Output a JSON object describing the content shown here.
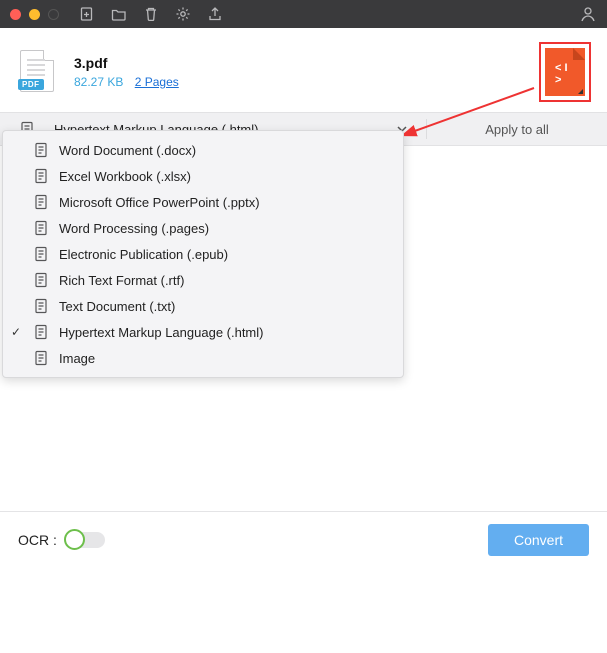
{
  "file": {
    "name": "3.pdf",
    "size": "82.27 KB",
    "pages_link": "2 Pages",
    "badge": "PDF",
    "target_code_glyph": "< I >"
  },
  "format_bar": {
    "selected": "Hypertext Markup Language (.html)",
    "apply_all": "Apply to all"
  },
  "dropdown": {
    "items": [
      {
        "label": "Word Document (.docx)",
        "checked": false
      },
      {
        "label": "Excel Workbook (.xlsx)",
        "checked": false
      },
      {
        "label": "Microsoft Office PowerPoint (.pptx)",
        "checked": false
      },
      {
        "label": "Word Processing (.pages)",
        "checked": false
      },
      {
        "label": "Electronic Publication (.epub)",
        "checked": false
      },
      {
        "label": "Rich Text Format (.rtf)",
        "checked": false
      },
      {
        "label": "Text Document (.txt)",
        "checked": false
      },
      {
        "label": "Hypertext Markup Language (.html)",
        "checked": true
      },
      {
        "label": "Image",
        "checked": false
      }
    ]
  },
  "footer": {
    "ocr_label": "OCR :",
    "ocr_on": false,
    "convert": "Convert"
  },
  "colors": {
    "accent": "#63aef0",
    "highlight": "#e33",
    "target": "#f1592a"
  }
}
